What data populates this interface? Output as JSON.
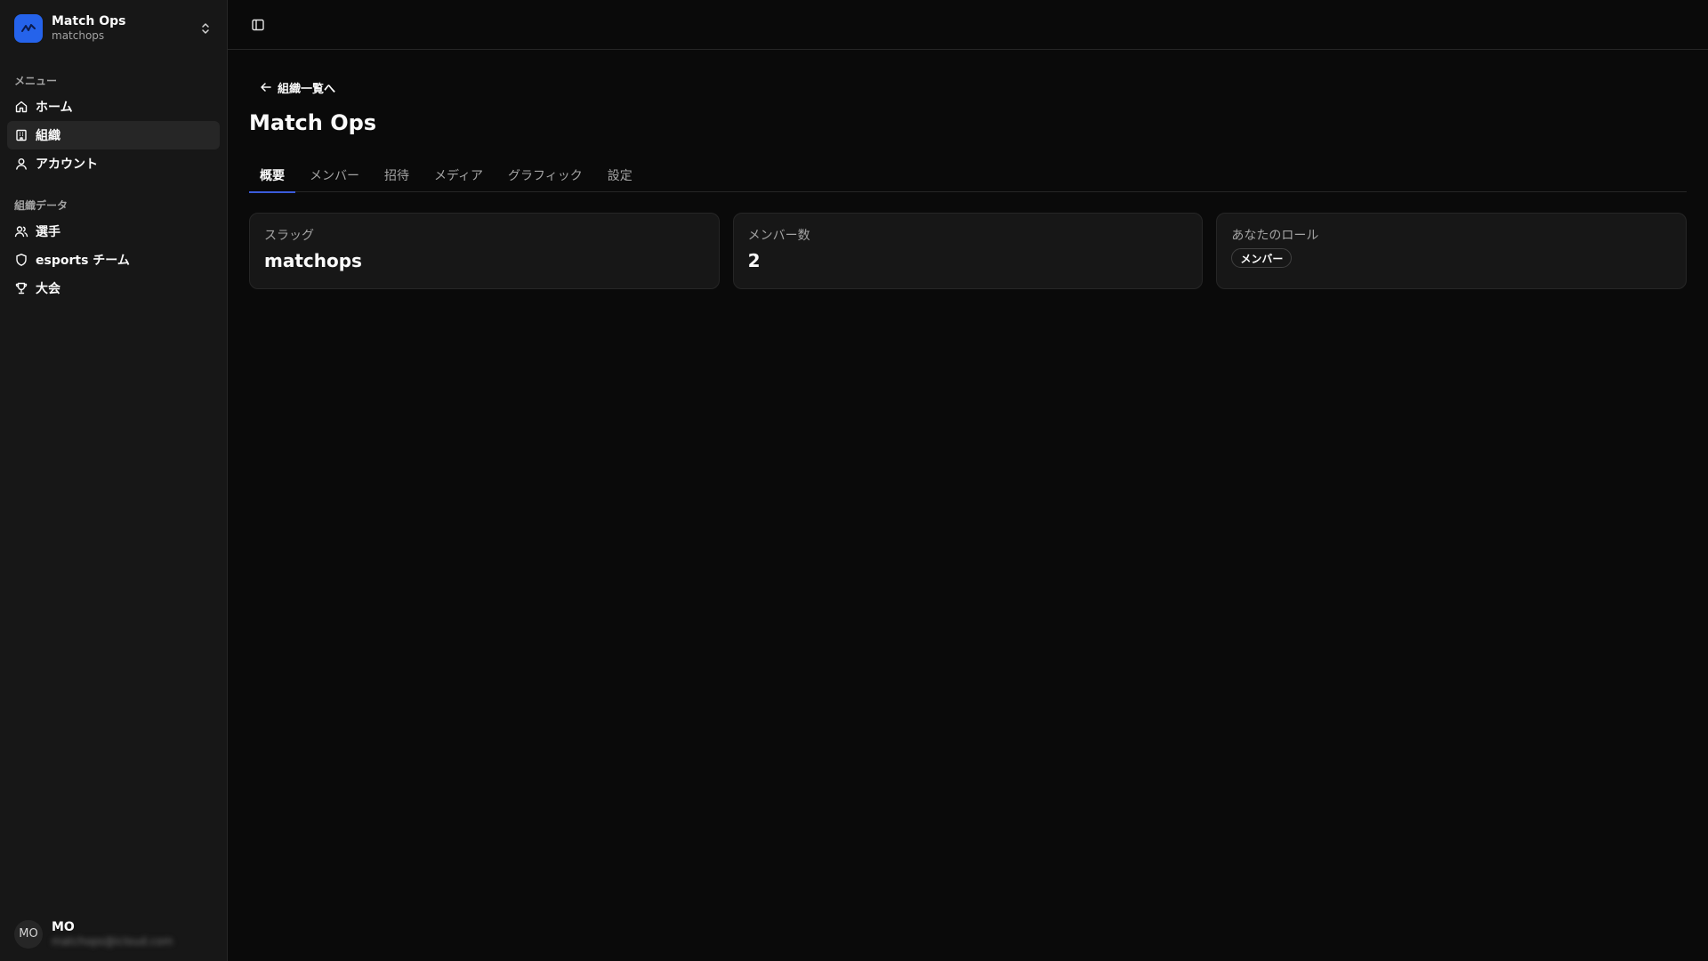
{
  "org": {
    "name": "Match Ops",
    "slug": "matchops"
  },
  "sidebar": {
    "menu_label": "メニュー",
    "menu_items": [
      {
        "label": "ホーム",
        "icon": "home-icon"
      },
      {
        "label": "組織",
        "icon": "building-icon",
        "active": true
      },
      {
        "label": "アカウント",
        "icon": "user-icon"
      }
    ],
    "org_data_label": "組織データ",
    "org_data_items": [
      {
        "label": "選手",
        "icon": "users-icon"
      },
      {
        "label": "esports チーム",
        "icon": "shield-icon"
      },
      {
        "label": "大会",
        "icon": "trophy-icon"
      }
    ]
  },
  "user": {
    "initials": "MO",
    "name": "MO",
    "email": "matchops@icloud.com"
  },
  "page": {
    "back_label": "組織一覧へ",
    "title": "Match Ops",
    "tabs": [
      "概要",
      "メンバー",
      "招待",
      "メディア",
      "グラフィック",
      "設定"
    ],
    "active_tab": 0,
    "cards": {
      "slug": {
        "label": "スラッグ",
        "value": "matchops"
      },
      "members": {
        "label": "メンバー数",
        "value": "2"
      },
      "role": {
        "label": "あなたのロール",
        "value": "メンバー"
      }
    }
  },
  "colors": {
    "accent": "#3b5bdb",
    "logo_bg": "#2563eb",
    "background": "#0a0a0a",
    "sidebar": "#171717"
  }
}
